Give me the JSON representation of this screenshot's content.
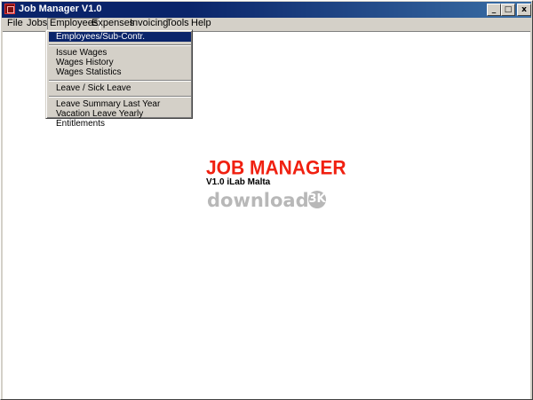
{
  "window": {
    "title": "Job Manager V1.0",
    "controls": {
      "minimize": "_",
      "maximize": "□",
      "close": "x"
    }
  },
  "menubar": {
    "items": [
      {
        "label": "File"
      },
      {
        "label": "Jobs"
      },
      {
        "label": "Employees"
      },
      {
        "label": "Expenses"
      },
      {
        "label": "Invoicing"
      },
      {
        "label": "Tools"
      },
      {
        "label": "Help"
      }
    ],
    "open_menu": "Employees"
  },
  "dropdown": {
    "items": [
      "Employees/Sub-Contr.",
      "Issue Wages",
      "Wages History",
      "Wages Statistics",
      "Leave / Sick Leave",
      "Leave Summary Last Year",
      "Vacation Leave Yearly Entitlements"
    ],
    "highlighted": "Employees/Sub-Contr."
  },
  "logo": {
    "title": "JOB MANAGER",
    "subtitle": "V1.0 iLab Malta",
    "title_color": "#f02010"
  },
  "watermark": {
    "text": "download",
    "badge": "3K"
  },
  "colors": {
    "titlebar": "#0a246a",
    "highlight": "#0a246a",
    "face": "#d4d0c8"
  }
}
